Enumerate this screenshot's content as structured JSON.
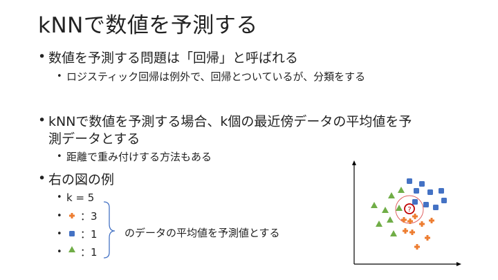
{
  "slide": {
    "title": "kNNで数値を予測する",
    "bullet1": "数値を予測する問題は「回帰」と呼ばれる",
    "bullet1_sub": "ロジスティック回帰は例外で、回帰とついているが、分類をする",
    "bullet2_line1": "kNNで数値を予測する場合、k個の最近傍データの平均値を予",
    "bullet2_line2": "測データとする",
    "bullet2_sub": "距離で重み付けする方法もある",
    "bullet3": "右の図の例",
    "example_k": "k = 5",
    "count_plus": "：3",
    "count_square": "：1",
    "count_triangle": "：1",
    "brace_note": "のデータの平均値を予測値とする",
    "query_label": "?"
  },
  "colors": {
    "triangle": "#70ad47",
    "square": "#4472c4",
    "plus": "#ed7d31",
    "query_ring": "#c00000",
    "radius_circle": "#e06060",
    "brace": "#4472c4"
  }
}
